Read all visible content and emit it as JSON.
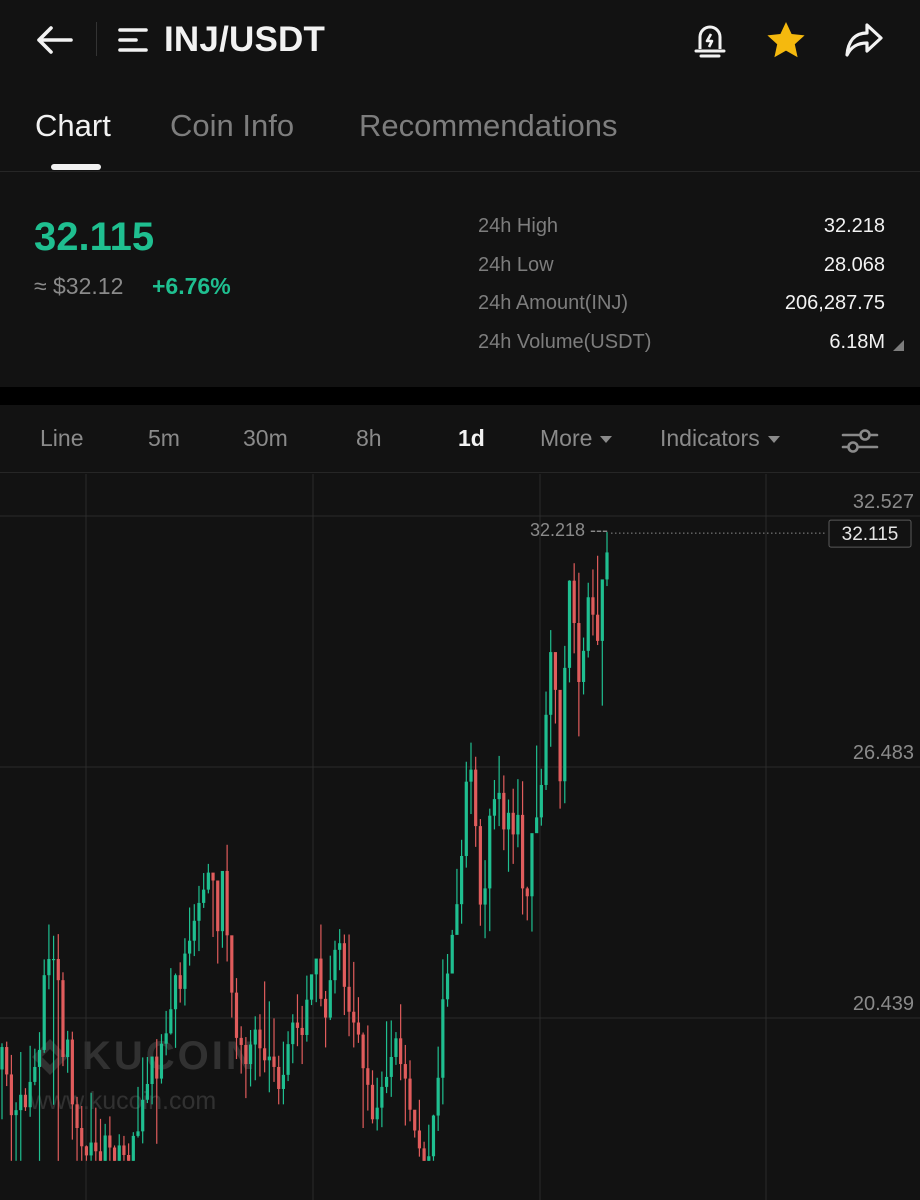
{
  "header": {
    "title": "INJ/USDT",
    "icons": [
      "back-arrow-icon",
      "menu-list-icon",
      "price-alert-icon",
      "favorite-star-icon",
      "share-icon"
    ],
    "star_color": "#f5b90e"
  },
  "tabs": [
    {
      "label": "Chart",
      "active": true
    },
    {
      "label": "Coin Info",
      "active": false
    },
    {
      "label": "Recommendations",
      "active": false
    }
  ],
  "ticker": {
    "last_price": "32.115",
    "fiat_price": "≈ $32.12",
    "change_pct": "+6.76%",
    "up_color": "#1fbf90",
    "down_color": "#e05c5c",
    "stats": [
      {
        "label": "24h High",
        "value": "32.218"
      },
      {
        "label": "24h Low",
        "value": "28.068"
      },
      {
        "label": "24h Amount(INJ)",
        "value": "206,287.75"
      },
      {
        "label": "24h Volume(USDT)",
        "value": "6.18M"
      }
    ]
  },
  "toolbar": {
    "intervals": [
      {
        "label": "Line",
        "active": false
      },
      {
        "label": "5m",
        "active": false
      },
      {
        "label": "30m",
        "active": false
      },
      {
        "label": "8h",
        "active": false
      },
      {
        "label": "1d",
        "active": true
      }
    ],
    "more_label": "More",
    "indicators_label": "Indicators"
  },
  "watermark": {
    "brand": "KUCOIN",
    "url": "www.kucoin.com"
  },
  "chart_data": {
    "type": "candlestick",
    "interval": "1d",
    "y_ticks": [
      "32.527",
      "26.483",
      "20.439"
    ],
    "y_range": [
      17.0,
      33.3
    ],
    "high_marker": "32.218 ---",
    "last_price_label": "32.115",
    "last_price": 32.115,
    "candles": [
      [
        19.2,
        19.74,
        18.0,
        19.83
      ],
      [
        19.74,
        19.08,
        18.8,
        19.87
      ],
      [
        19.08,
        18.1,
        17.0,
        19.55
      ],
      [
        18.1,
        18.22,
        17.0,
        18.41
      ],
      [
        18.22,
        18.59,
        17.0,
        19.62
      ],
      [
        18.59,
        18.29,
        18.2,
        18.75
      ],
      [
        18.29,
        18.9,
        18.06,
        19.77
      ],
      [
        18.9,
        19.26,
        18.82,
        19.7
      ],
      [
        19.26,
        19.67,
        17.0,
        20.1
      ],
      [
        19.67,
        21.47,
        19.6,
        21.85
      ],
      [
        21.47,
        21.86,
        21.13,
        22.69
      ],
      [
        21.86,
        21.86,
        18.35,
        22.42
      ],
      [
        21.86,
        21.35,
        17.0,
        22.46
      ],
      [
        21.35,
        19.5,
        19.28,
        21.54
      ],
      [
        19.5,
        19.92,
        19.12,
        20.13
      ],
      [
        19.92,
        18.36,
        17.51,
        20.11
      ],
      [
        18.36,
        17.79,
        17.0,
        18.54
      ],
      [
        17.79,
        17.35,
        17.0,
        18.32
      ],
      [
        17.35,
        17.13,
        17.0,
        17.37
      ],
      [
        17.13,
        17.44,
        17.0,
        18.64
      ],
      [
        17.44,
        17.23,
        17.0,
        18.28
      ],
      [
        17.23,
        17.0,
        17.0,
        18.01
      ],
      [
        17.0,
        17.61,
        17.0,
        17.89
      ],
      [
        17.61,
        17.32,
        17.0,
        18.07
      ],
      [
        17.32,
        17.0,
        17.0,
        17.37
      ],
      [
        17.0,
        17.37,
        17.0,
        17.64
      ],
      [
        17.37,
        17.14,
        17.0,
        17.6
      ],
      [
        17.14,
        17.0,
        17.0,
        17.42
      ],
      [
        17.0,
        17.6,
        17.0,
        17.69
      ],
      [
        17.6,
        17.71,
        17.56,
        18.78
      ],
      [
        17.71,
        18.47,
        17.42,
        19.49
      ],
      [
        18.47,
        18.85,
        18.39,
        19.5
      ],
      [
        18.85,
        19.51,
        18.36,
        19.51
      ],
      [
        19.51,
        18.98,
        17.41,
        19.93
      ],
      [
        18.98,
        19.82,
        18.86,
        20.05
      ],
      [
        19.82,
        20.07,
        19.54,
        20.61
      ],
      [
        20.07,
        20.65,
        20.04,
        21.64
      ],
      [
        20.65,
        21.47,
        19.72,
        21.51
      ],
      [
        21.47,
        21.14,
        20.81,
        21.78
      ],
      [
        21.14,
        21.99,
        20.74,
        22.36
      ],
      [
        21.99,
        22.3,
        21.7,
        23.1
      ],
      [
        22.3,
        22.78,
        21.93,
        23.18
      ],
      [
        22.78,
        23.21,
        22.05,
        23.62
      ],
      [
        23.21,
        23.53,
        23.09,
        23.93
      ],
      [
        23.53,
        23.94,
        23.44,
        24.15
      ],
      [
        23.94,
        23.75,
        22.39,
        23.92
      ],
      [
        23.75,
        22.53,
        21.75,
        23.68
      ],
      [
        22.53,
        23.98,
        22.13,
        23.9
      ],
      [
        23.98,
        22.43,
        21.8,
        24.61
      ],
      [
        22.43,
        21.05,
        20.45,
        21.97
      ],
      [
        21.05,
        19.96,
        19.45,
        21.4
      ],
      [
        19.96,
        19.79,
        19.1,
        20.24
      ],
      [
        19.79,
        19.33,
        18.51,
        19.98
      ],
      [
        19.33,
        19.8,
        18.79,
        20.15
      ],
      [
        19.8,
        20.16,
        18.94,
        20.48
      ],
      [
        20.16,
        19.71,
        19.03,
        20.53
      ],
      [
        19.71,
        19.42,
        19.13,
        21.32
      ],
      [
        19.42,
        19.51,
        18.65,
        20.84
      ],
      [
        19.51,
        19.26,
        18.9,
        20.43
      ],
      [
        19.26,
        18.73,
        18.36,
        19.53
      ],
      [
        18.73,
        19.07,
        18.36,
        19.87
      ],
      [
        19.07,
        19.81,
        18.92,
        20.12
      ],
      [
        19.81,
        20.33,
        19.35,
        20.53
      ],
      [
        20.33,
        20.2,
        19.76,
        21.01
      ],
      [
        20.2,
        20.03,
        19.33,
        20.73
      ],
      [
        20.03,
        20.88,
        19.87,
        21.46
      ],
      [
        20.88,
        21.49,
        20.75,
        21.44
      ],
      [
        21.49,
        21.87,
        20.82,
        21.83
      ],
      [
        21.87,
        20.9,
        20.72,
        22.69
      ],
      [
        20.9,
        20.45,
        19.73,
        21.09
      ],
      [
        20.45,
        21.35,
        20.39,
        21.94
      ],
      [
        21.35,
        22.08,
        21.03,
        22.3
      ],
      [
        22.08,
        22.24,
        21.59,
        22.58
      ],
      [
        22.24,
        21.19,
        20.51,
        22.45
      ],
      [
        21.19,
        20.59,
        20.0,
        22.45
      ],
      [
        20.59,
        20.33,
        19.73,
        21.79
      ],
      [
        20.33,
        20.04,
        19.84,
        20.94
      ],
      [
        20.04,
        19.23,
        17.79,
        20.09
      ],
      [
        19.23,
        18.83,
        18.21,
        20.26
      ],
      [
        18.83,
        18.0,
        17.9,
        19.18
      ],
      [
        18.0,
        18.28,
        17.73,
        19.0
      ],
      [
        18.28,
        18.78,
        17.81,
        19.15
      ],
      [
        18.78,
        19.02,
        18.63,
        20.36
      ],
      [
        19.02,
        19.5,
        18.54,
        20.38
      ],
      [
        19.5,
        19.95,
        19.31,
        20.1
      ],
      [
        19.95,
        19.33,
        18.94,
        20.77
      ],
      [
        19.33,
        18.98,
        17.85,
        19.79
      ],
      [
        18.98,
        18.23,
        17.95,
        19.42
      ],
      [
        18.23,
        17.73,
        17.56,
        18.15
      ],
      [
        17.73,
        17.3,
        17.1,
        18.47
      ],
      [
        17.3,
        17.0,
        17.0,
        17.46
      ],
      [
        17.0,
        17.11,
        17.0,
        17.87
      ],
      [
        17.11,
        18.09,
        17.0,
        18.11
      ],
      [
        18.09,
        19.0,
        17.72,
        19.75
      ],
      [
        19.0,
        20.89,
        18.36,
        21.85
      ],
      [
        20.89,
        21.51,
        20.71,
        21.98
      ],
      [
        21.51,
        22.44,
        21.6,
        22.56
      ],
      [
        22.44,
        23.18,
        22.74,
        24.03
      ],
      [
        23.18,
        24.34,
        22.71,
        24.73
      ],
      [
        24.34,
        26.13,
        24.06,
        26.61
      ],
      [
        26.13,
        26.42,
        25.35,
        27.07
      ],
      [
        26.42,
        25.06,
        24.56,
        26.73
      ],
      [
        25.06,
        23.17,
        22.66,
        25.23
      ],
      [
        23.17,
        23.56,
        22.36,
        24.24
      ],
      [
        23.56,
        25.31,
        22.53,
        25.48
      ],
      [
        25.31,
        25.71,
        24.98,
        26.17
      ],
      [
        25.71,
        25.86,
        25.06,
        26.75
      ],
      [
        25.86,
        24.98,
        24.48,
        26.28
      ],
      [
        24.98,
        25.38,
        23.96,
        25.7
      ],
      [
        25.38,
        24.86,
        24.15,
        25.96
      ],
      [
        24.86,
        25.33,
        24.55,
        26.19
      ],
      [
        25.33,
        23.56,
        22.93,
        26.14
      ],
      [
        23.56,
        23.37,
        22.79,
        23.6
      ],
      [
        23.37,
        24.89,
        22.52,
        24.74
      ],
      [
        24.89,
        25.27,
        24.95,
        27.0
      ],
      [
        25.27,
        26.05,
        25.07,
        26.44
      ],
      [
        26.05,
        27.74,
        25.93,
        28.3
      ],
      [
        27.74,
        29.25,
        26.97,
        29.78
      ],
      [
        29.25,
        28.34,
        27.53,
        29.19
      ],
      [
        28.34,
        26.14,
        25.48,
        28.13
      ],
      [
        26.14,
        28.87,
        25.61,
        29.4
      ],
      [
        28.87,
        30.97,
        28.52,
        30.98
      ],
      [
        30.97,
        29.95,
        29.22,
        31.39
      ],
      [
        29.95,
        28.53,
        27.22,
        31.16
      ],
      [
        28.53,
        29.28,
        28.23,
        29.6
      ],
      [
        29.28,
        30.57,
        29.12,
        30.92
      ],
      [
        30.57,
        30.15,
        29.65,
        31.24
      ],
      [
        30.15,
        29.52,
        29.42,
        31.57
      ],
      [
        29.52,
        31.0,
        27.96,
        30.96
      ],
      [
        31.0,
        31.65,
        30.84,
        32.14
      ]
    ]
  }
}
